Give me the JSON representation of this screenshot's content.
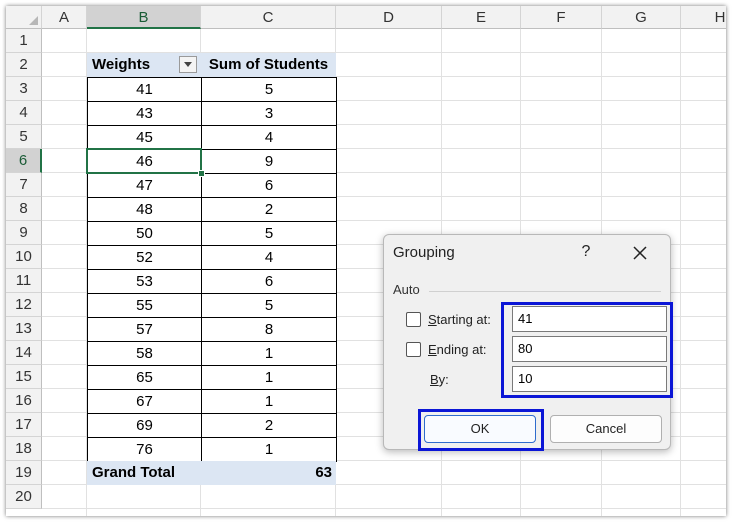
{
  "sheet": {
    "columns": [
      "A",
      "B",
      "C",
      "D",
      "E",
      "F",
      "G",
      "H"
    ],
    "rows": [
      "1",
      "2",
      "3",
      "4",
      "5",
      "6",
      "7",
      "8",
      "9",
      "10",
      "11",
      "12",
      "13",
      "14",
      "15",
      "16",
      "17",
      "18",
      "19",
      "20"
    ],
    "selected_column": "B",
    "selected_row": "6"
  },
  "pivot": {
    "header_row_label": "Weights",
    "header_value_label": "Sum of Students",
    "rows": [
      {
        "weight": "41",
        "students": "5"
      },
      {
        "weight": "43",
        "students": "3"
      },
      {
        "weight": "45",
        "students": "4"
      },
      {
        "weight": "46",
        "students": "9"
      },
      {
        "weight": "47",
        "students": "6"
      },
      {
        "weight": "48",
        "students": "2"
      },
      {
        "weight": "50",
        "students": "5"
      },
      {
        "weight": "52",
        "students": "4"
      },
      {
        "weight": "53",
        "students": "6"
      },
      {
        "weight": "55",
        "students": "5"
      },
      {
        "weight": "57",
        "students": "8"
      },
      {
        "weight": "58",
        "students": "1"
      },
      {
        "weight": "65",
        "students": "1"
      },
      {
        "weight": "67",
        "students": "1"
      },
      {
        "weight": "69",
        "students": "2"
      },
      {
        "weight": "76",
        "students": "1"
      }
    ],
    "total_label": "Grand Total",
    "total_value": "63"
  },
  "dialog": {
    "title": "Grouping",
    "help": "?",
    "group_label": "Auto",
    "starting_label_key": "S",
    "starting_label_rest": "tarting at:",
    "ending_label_key": "E",
    "ending_label_rest": "nding at:",
    "by_label_key": "B",
    "by_label_rest": "y:",
    "starting_value": "41",
    "ending_value": "80",
    "by_value": "10",
    "ok_label": "OK",
    "cancel_label": "Cancel"
  },
  "colors": {
    "excel_green": "#217346",
    "pivot_header": "#dce6f3",
    "highlight_blue": "#0b16d6"
  }
}
